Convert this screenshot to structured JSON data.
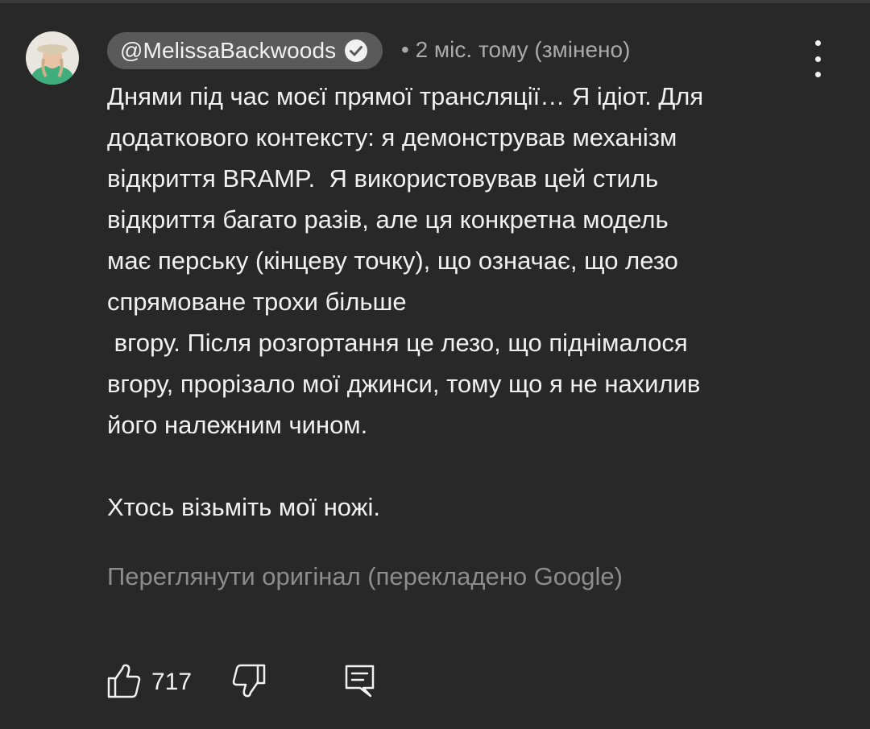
{
  "comment": {
    "author": "@MelissaBackwoods",
    "verified": true,
    "meta": "• 2 міс. тому (змінено)",
    "lines": [
      "Днями під час моєї прямої трансляції… Я ідіот. Для",
      "додаткового контексту: я демонстрував механізм",
      "відкриття BRAMP.  Я використовував цей стиль",
      "відкриття багато разів, але ця конкретна модель",
      "має перську (кінцеву точку), що означає, що лезо",
      "спрямоване трохи більше",
      " вгору. Після розгортання це лезо, що піднімалося",
      "вгору, прорізало мої джинси, тому що я не нахилив",
      "його належним чином.",
      "",
      "Хтось візьміть мої ножі."
    ],
    "see_original": "Переглянути оригінал (перекладено Google)",
    "like_count": "717"
  },
  "icons": {
    "avatar": "avatar-photo",
    "verified": "check-circle-icon",
    "menu": "more-vertical-icon",
    "like": "thumb-up-icon",
    "dislike": "thumb-down-icon",
    "reply": "reply-comment-icon"
  },
  "colors": {
    "background": "#282828",
    "chip": "#5a5a5a",
    "text": "#f1f1f1",
    "secondary": "#aaaaaa",
    "muted": "#8d8d8d"
  }
}
